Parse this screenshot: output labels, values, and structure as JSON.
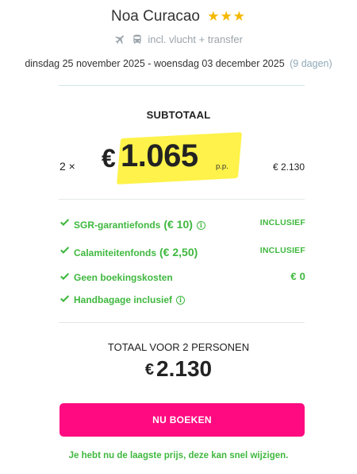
{
  "hotel": {
    "name": "Noa Curacao",
    "stars": "★★★"
  },
  "package": {
    "inclusion": "incl. vlucht + transfer"
  },
  "travel": {
    "dates": "dinsdag 25 november 2025 - woensdag 03 december 2025",
    "duration": "(9 dagen)"
  },
  "subtotal": {
    "label": "SUBTOTAAL",
    "quantity": "2 ×",
    "currency": "€",
    "price_per_person": "1.065",
    "pp_label": "p.p.",
    "line_total": "€ 2.130"
  },
  "features": [
    {
      "name": "SGR-garantiefonds",
      "extra": "(€ 10)",
      "has_info": true,
      "status": "INCLUSIEF"
    },
    {
      "name": "Calamiteitenfonds",
      "extra": "(€ 2,50)",
      "has_info": false,
      "status": "INCLUSIEF"
    },
    {
      "name": "Geen boekingskosten",
      "extra": "",
      "has_info": false,
      "status": "€ 0"
    },
    {
      "name": "Handbagage inclusief",
      "extra": "",
      "has_info": true,
      "status": ""
    }
  ],
  "total": {
    "label": "TOTAAL VOOR 2 PERSONEN",
    "currency": "€",
    "amount": "2.130"
  },
  "cta": {
    "label": "NU BOEKEN"
  },
  "notice": "Je hebt nu de laagste prijs, deze kan snel wijzigen.",
  "colors": {
    "accent": "#ff0a80",
    "success": "#3fb83f",
    "star": "#f5b800",
    "highlight": "#fff02a"
  },
  "icons": {
    "flight": "plane-icon",
    "transfer": "bus-icon",
    "check": "check-icon",
    "info": "info-icon"
  }
}
